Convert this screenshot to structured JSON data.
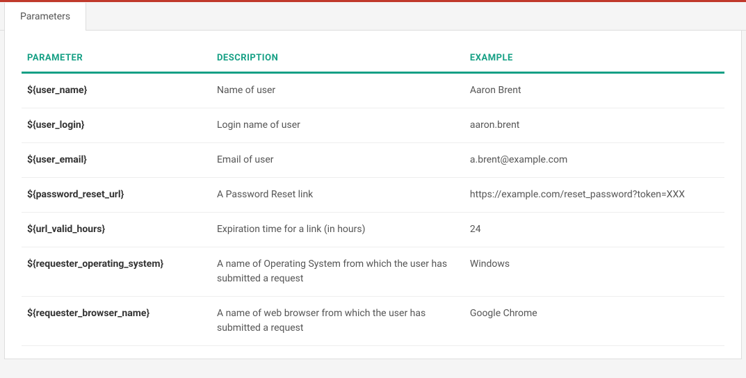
{
  "tabs": [
    {
      "label": "Parameters"
    }
  ],
  "table": {
    "headers": {
      "parameter": "PARAMETER",
      "description": "DESCRIPTION",
      "example": "EXAMPLE"
    },
    "rows": [
      {
        "parameter": "${user_name}",
        "description": "Name of user",
        "example": "Aaron Brent"
      },
      {
        "parameter": "${user_login}",
        "description": "Login name of user",
        "example": "aaron.brent"
      },
      {
        "parameter": "${user_email}",
        "description": "Email of user",
        "example": "a.brent@example.com"
      },
      {
        "parameter": "${password_reset_url}",
        "description": "A Password Reset link",
        "example": "https://example.com/reset_password?token=XXX"
      },
      {
        "parameter": "${url_valid_hours}",
        "description": "Expiration time for a link (in hours)",
        "example": "24"
      },
      {
        "parameter": "${requester_operating_system}",
        "description": "A name of Operating System from which the user has submitted a request",
        "example": "Windows"
      },
      {
        "parameter": "${requester_browser_name}",
        "description": "A name of web browser from which the user has submitted a request",
        "example": "Google Chrome"
      }
    ]
  }
}
